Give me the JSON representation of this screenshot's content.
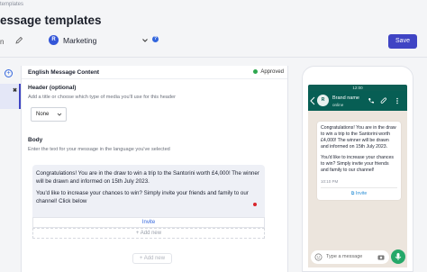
{
  "breadcrumb": "templates",
  "page_title": "essage templates",
  "toolbar": {
    "name_label": "n",
    "account_initial": "R",
    "account_name": "Marketing",
    "help_glyph": "?",
    "save_label": "Save"
  },
  "sidebar": {
    "add_glyph": "+",
    "remove_glyph": "✖"
  },
  "editor": {
    "language_title": "English Message Content",
    "status": "Approved",
    "status_color": "#2fa84f",
    "header": {
      "title": "Header (optional)",
      "subtitle": "Add a title or choose which type of media you'll use for this header",
      "media_type": "None"
    },
    "body": {
      "title": "Body",
      "subtitle": "Enter the text for your message in the language you've selected",
      "paragraph1": "Congratulations! You are in the draw to win a trip to the Santorini worth £4,000! The winner will be drawn and informed on 15th July 2023.",
      "paragraph2": "You'd like to increase your chances to win? Simply invite your friends and family to our channel! Click below"
    },
    "button_label": "Invite",
    "add_new_label": "+ Add new",
    "add_new_label_2": "+ Add new"
  },
  "preview": {
    "status_time": "12:00",
    "brand_initial": "R",
    "brand_name": "Brand name",
    "brand_status": "online",
    "bubble_paragraph1": "Congratulations! You are in the draw to win a trip to the Santorini worth £4,000! The winner will be drawn and informed on 15th July 2023.",
    "bubble_paragraph2": "You'd like to increase your chances to win? Simply invite your friends and family to our channel!",
    "bubble_time": "10:10 PM",
    "bubble_button": "Invite",
    "compose_placeholder": "Type a message",
    "header_color": "#075e54",
    "chat_bg_color": "#ece5dd",
    "mic_color": "#25a869"
  }
}
